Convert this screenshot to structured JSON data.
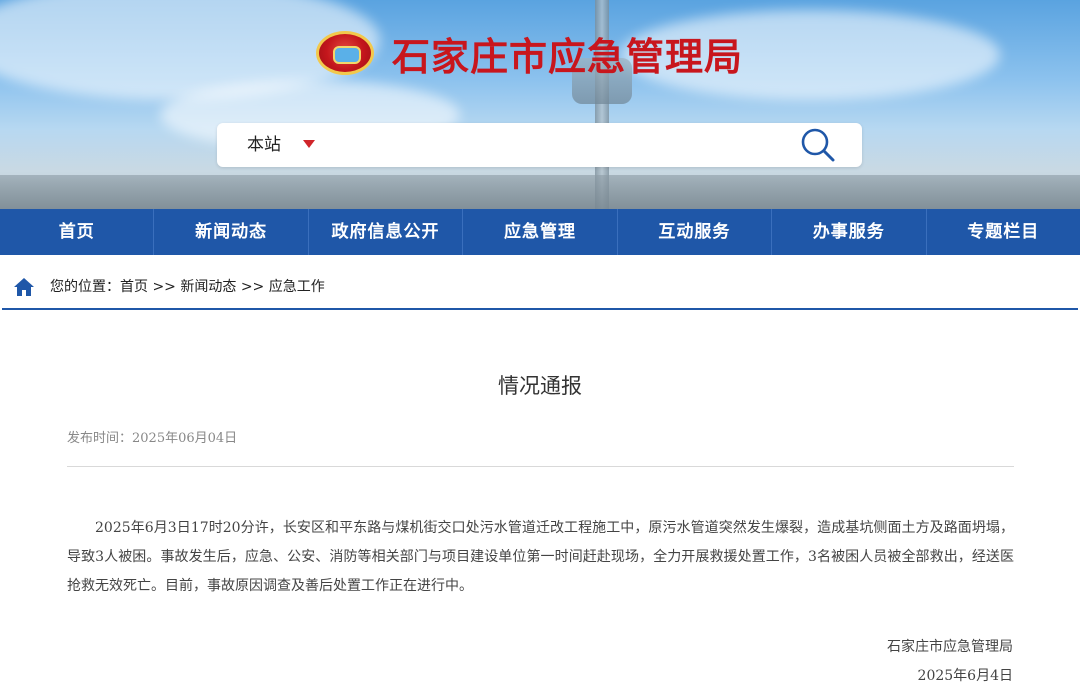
{
  "site": {
    "title": "石家庄市应急管理局",
    "search_scope": "本站",
    "brand_red": "#c8161d",
    "nav_blue": "#1f57a8"
  },
  "nav": [
    "首页",
    "新闻动态",
    "政府信息公开",
    "应急管理",
    "互动服务",
    "办事服务",
    "专题栏目"
  ],
  "breadcrumb": {
    "label": "您的位置：",
    "items": [
      "首页",
      "新闻动态",
      "应急工作"
    ],
    "separator": " >> "
  },
  "article": {
    "title": "情况通报",
    "publish_time": "发布时间：2025年06月04日",
    "body": "2025年6月3日17时20分许，长安区和平东路与煤机街交口处污水管道迁改工程施工中，原污水管道突然发生爆裂，造成基坑侧面土方及路面坍塌，导致3人被困。事故发生后，应急、公安、消防等相关部门与项目建设单位第一时间赶赴现场，全力开展救援处置工作，3名被困人员被全部救出，经送医抢救无效死亡。目前，事故原因调查及善后处置工作正在进行中。",
    "signature_org": "石家庄市应急管理局",
    "signature_date": "2025年6月4日"
  },
  "icons": {
    "emblem": "city-emblem-icon",
    "search": "search-icon",
    "scope_dropdown": "caret-down-icon",
    "home": "home-icon"
  }
}
